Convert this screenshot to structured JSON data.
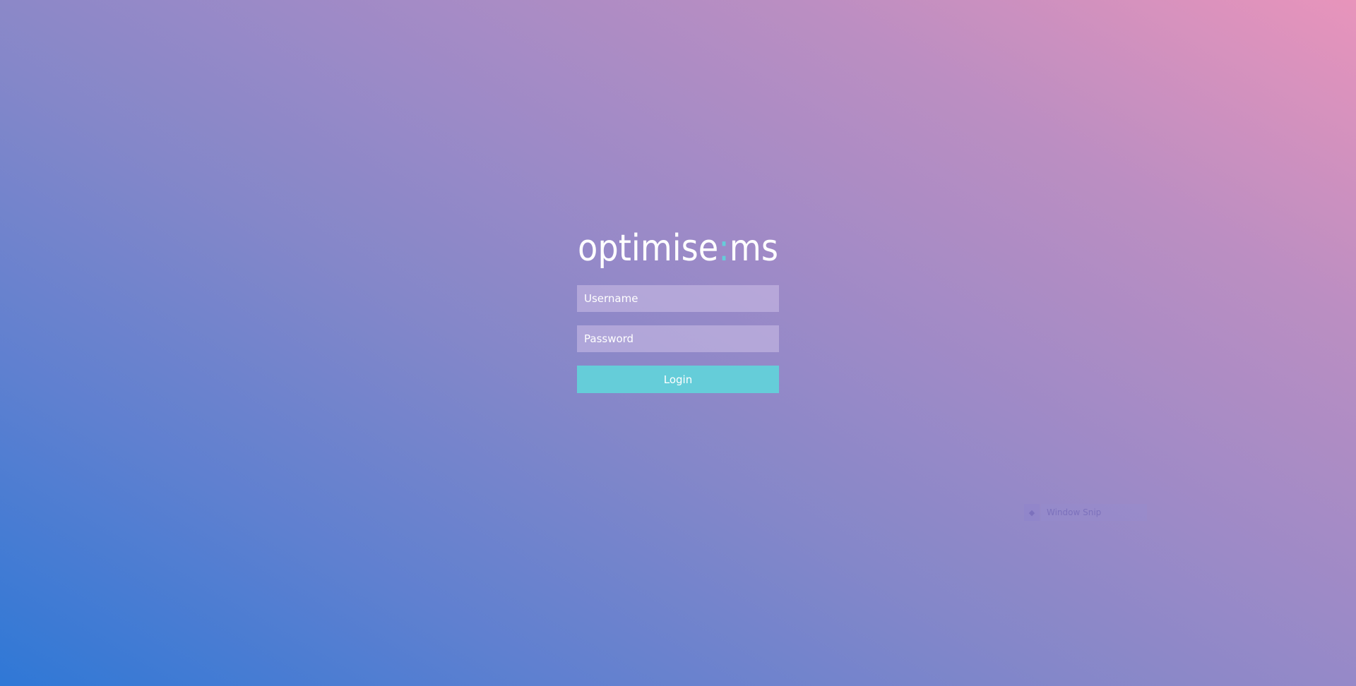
{
  "brand": {
    "logo_text_left": "optimise",
    "logo_separator": ":",
    "logo_text_right": "ms",
    "logo_color": "#ffffff",
    "separator_color": "#65cdd9"
  },
  "login_form": {
    "username_placeholder": "Username",
    "password_placeholder": "Password",
    "login_label": "Login",
    "button_color": "#65cdd9"
  },
  "overlay": {
    "window_snip_label": "Window Snip",
    "window_snip_icon": "snip-icon"
  }
}
